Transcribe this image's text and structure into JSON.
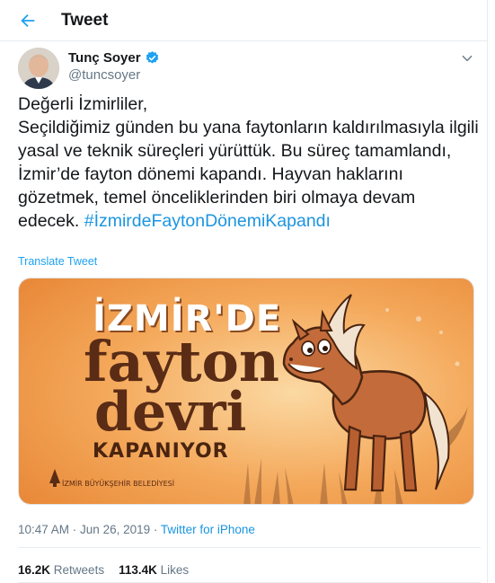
{
  "header": {
    "title": "Tweet"
  },
  "author": {
    "name": "Tunç Soyer",
    "handle": "@tuncsoyer",
    "verified": true
  },
  "tweet": {
    "text": "Değerli İzmirliler,\nSeçildiğimiz günden bu yana faytonların kaldırılmasıyla ilgili yasal ve teknik süreçleri yürüttük. Bu süreç tamamlandı, İzmir’de fayton dönemi kapandı. Hayvan haklarını gözetmek, temel önceliklerinden biri olmaya devam edecek. ",
    "hashtag": "#İzmirdeFaytonDönemiKapandı",
    "translate_label": "Translate Tweet"
  },
  "media": {
    "line1": "İZMİR'DE",
    "line2": "fayton",
    "line3": "devri",
    "line4": "KAPANIYOR",
    "logo_text": "İZMİR BÜYÜKŞEHİR BELEDİYESİ"
  },
  "meta": {
    "time": "10:47 AM",
    "sep": " · ",
    "date": "Jun 26, 2019",
    "source": "Twitter for iPhone"
  },
  "stats": {
    "retweets_count": "16.2K",
    "retweets_label": "Retweets",
    "likes_count": "113.4K",
    "likes_label": "Likes"
  },
  "colors": {
    "accent": "#1da1f2",
    "text": "#14171a",
    "muted": "#657786",
    "verified": "#1da1f2",
    "poster_bg": "#f3a04c",
    "poster_text": "#5a2c16"
  }
}
